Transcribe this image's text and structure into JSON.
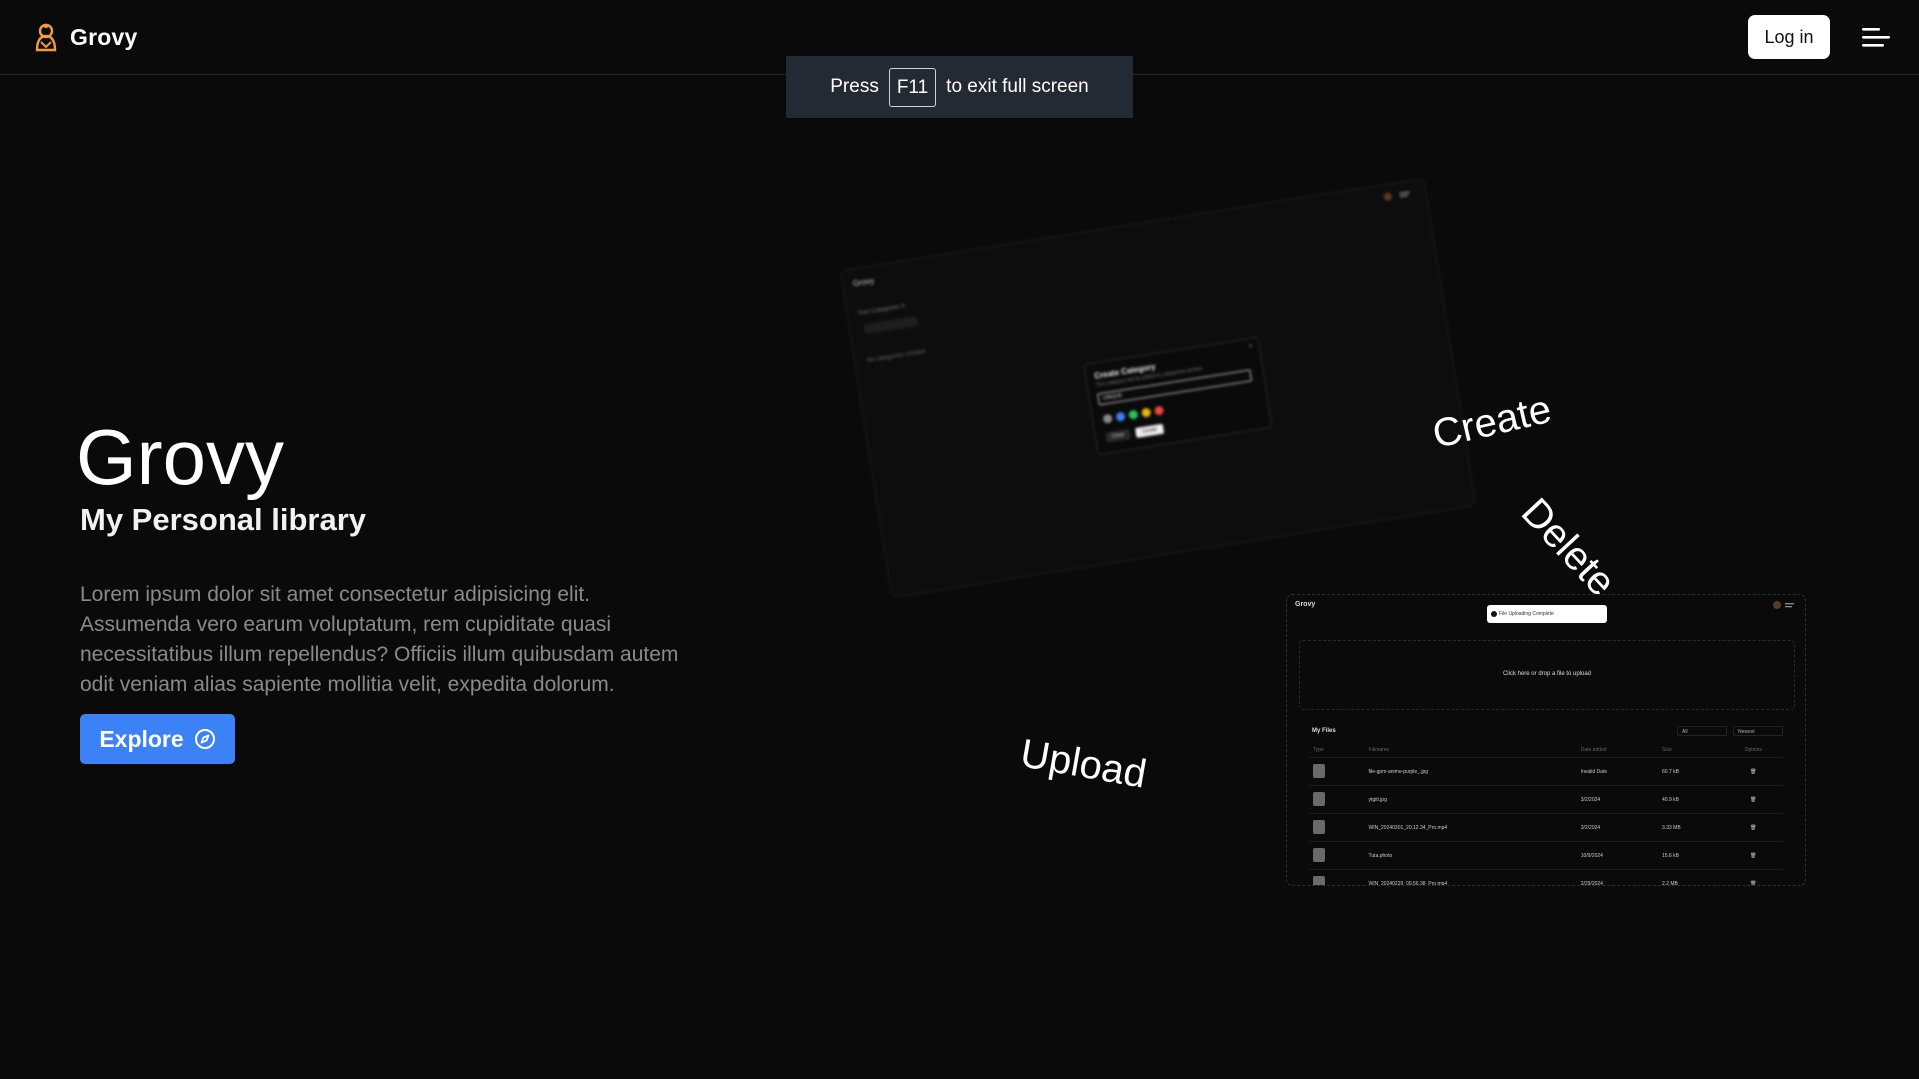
{
  "header": {
    "brand_name": "Grovy",
    "login_label": "Log in",
    "menu_icon": "menu-icon",
    "brand_icon": "grovy-logo-icon",
    "brand_color": "#f39c3c"
  },
  "fullscreen_notice": {
    "prefix": "Press",
    "key": "F11",
    "suffix": "to exit full screen"
  },
  "hero": {
    "title": "Grovy",
    "subtitle": "My Personal library",
    "description": "Lorem ipsum dolor sit amet consectetur adipisicing elit. Assumenda vero earum voluptatum, rem cupiditate quasi necessitatibus illum repellendus? Officiis illum quibusdam autem odit veniam alias sapiente mollitia velit, expedita dolorum.",
    "explore_label": "Explore",
    "explore_icon": "compass-icon",
    "accent_color": "#3b82f6"
  },
  "feature_labels": {
    "create": "Create",
    "delete": "Delete",
    "upload": "Upload"
  },
  "preview_create": {
    "logo": "Grovy",
    "side_title": "Your Categories 0",
    "side_chip": "Add Category",
    "empty_text": "No categories created",
    "dialog_title": "Create Category",
    "dialog_desc": "This category will be added to categories section",
    "input_value": "UNIQUE",
    "close_label": "Close",
    "create_label": "Create",
    "dot_colors": [
      "#8a8a8a",
      "#3b82f6",
      "#22c55e",
      "#eab308",
      "#ef4444"
    ]
  },
  "preview_upload": {
    "logo": "Grovy",
    "toast_text": "File Uploading Complete",
    "drop_text": "Click here or drop a file to upload",
    "files_title": "My Files",
    "filter_type": "All",
    "filter_sort": "Newest",
    "columns": [
      "Type",
      "Filename",
      "Date added",
      "Size",
      "Options"
    ],
    "rows": [
      {
        "name": "file-gpm-anime-purple_.jpg",
        "date": "Invalid Date",
        "size": "60.7 kB"
      },
      {
        "name": "ytgiti.jpg",
        "date": "3/2/2024",
        "size": "40.9 kB"
      },
      {
        "name": "WIN_20240301_20.12.34_Pro.mp4",
        "date": "3/2/2024",
        "size": "3.33 MB"
      },
      {
        "name": "Tuta.photo",
        "date": "10/9/2024",
        "size": "15.6 kB"
      },
      {
        "name": "WIN_20240229_09.56.38_Pro.mp4",
        "date": "2/29/2024",
        "size": "2.2 MB"
      }
    ]
  }
}
